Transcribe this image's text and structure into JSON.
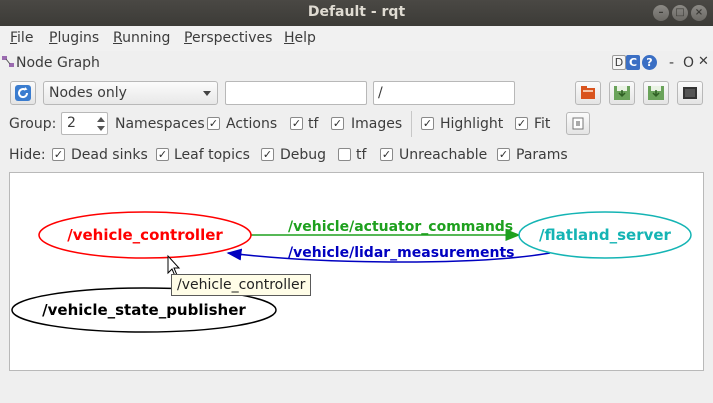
{
  "window": {
    "title": "Default - rqt",
    "buttons": [
      "minimize-icon",
      "maximize-icon",
      "close-icon"
    ]
  },
  "menubar": {
    "items": [
      {
        "label": "File",
        "mnemonic": "F"
      },
      {
        "label": "Plugins",
        "mnemonic": "P"
      },
      {
        "label": "Running",
        "mnemonic": "R"
      },
      {
        "label": "Perspectives",
        "mnemonic": "P"
      },
      {
        "label": "Help",
        "mnemonic": "H"
      }
    ]
  },
  "plugin": {
    "title": "Node Graph",
    "header_buttons": {
      "d_label": "D",
      "c_label": "C",
      "help_label": "?",
      "minus_label": "-",
      "float_label": "O",
      "close_label": "✕"
    }
  },
  "toolbar": {
    "graph_type": "Nodes only",
    "filter_value": "",
    "namespace_value": "/",
    "icons": [
      "refresh-icon",
      "load-dot-icon",
      "save-dot-icon",
      "save-svg-icon",
      "save-image-icon"
    ]
  },
  "options": {
    "group_label": "Group:",
    "group_value": "2",
    "namespaces": {
      "label": "Namespaces",
      "checked": true
    },
    "actions": {
      "label": "Actions",
      "checked": true
    },
    "tf": {
      "label": "tf",
      "checked": true
    },
    "images": {
      "label": "Images",
      "checked": true
    },
    "highlight": {
      "label": "Highlight",
      "checked": true
    },
    "fit": {
      "label": "Fit",
      "checked": true
    }
  },
  "hide": {
    "label": "Hide:",
    "dead_sinks": {
      "label": "Dead sinks",
      "checked": true
    },
    "leaf_topics": {
      "label": "Leaf topics",
      "checked": true
    },
    "debug": {
      "label": "Debug",
      "checked": true
    },
    "tf": {
      "label": "tf",
      "checked": false
    },
    "unreachable": {
      "label": "Unreachable",
      "checked": true
    },
    "params": {
      "label": "Params",
      "checked": true
    }
  },
  "graph": {
    "nodes": [
      {
        "name": "/vehicle_controller",
        "color": "#ff0000"
      },
      {
        "name": "/flatland_server",
        "color": "#14b4b4"
      },
      {
        "name": "/vehicle_state_publisher",
        "color": "#000000"
      }
    ],
    "edges": [
      {
        "topic": "/vehicle/actuator_commands",
        "from": "/vehicle_controller",
        "to": "/flatland_server",
        "color": "#1ea01e"
      },
      {
        "topic": "/vehicle/lidar_measurements",
        "from": "/flatland_server",
        "to": "/vehicle_controller",
        "color": "#0000c0"
      }
    ]
  },
  "tooltip": "/vehicle_controller",
  "check_mark": "✓"
}
